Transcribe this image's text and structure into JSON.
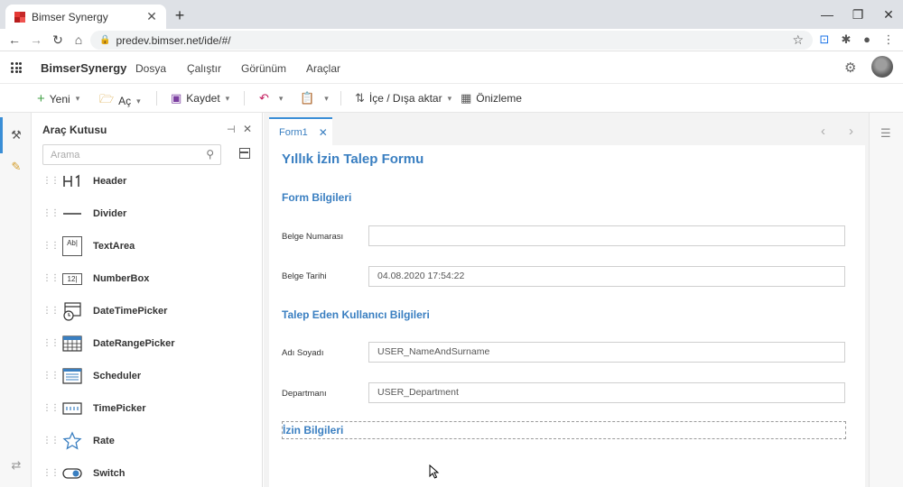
{
  "browser": {
    "tab_title": "Bimser Synergy",
    "url": "predev.bimser.net/ide/#/"
  },
  "app": {
    "brand": "BimserSynergy",
    "menu": [
      "Dosya",
      "Çalıştır",
      "Görünüm",
      "Araçlar"
    ]
  },
  "toolbar": {
    "new_label": "Yeni",
    "open_label": "Aç",
    "save_label": "Kaydet",
    "import_export_label": "İçe / Dışa aktar",
    "preview_label": "Önizleme"
  },
  "toolbox": {
    "title": "Araç Kutusu",
    "search_placeholder": "Arama",
    "items": [
      {
        "label": "Header",
        "icon": "header-icon"
      },
      {
        "label": "Divider",
        "icon": "divider-icon"
      },
      {
        "label": "TextArea",
        "icon": "textarea-icon"
      },
      {
        "label": "NumberBox",
        "icon": "numberbox-icon"
      },
      {
        "label": "DateTimePicker",
        "icon": "datetimepicker-icon"
      },
      {
        "label": "DateRangePicker",
        "icon": "daterangepicker-icon"
      },
      {
        "label": "Scheduler",
        "icon": "scheduler-icon"
      },
      {
        "label": "TimePicker",
        "icon": "timepicker-icon"
      },
      {
        "label": "Rate",
        "icon": "star-icon"
      },
      {
        "label": "Switch",
        "icon": "switch-icon"
      }
    ],
    "textarea_glyph": "Ab|",
    "numberbox_glyph": "12|"
  },
  "designer": {
    "tab_label": "Form1",
    "form_title": "Yıllık İzin Talep Formu",
    "sections": {
      "form_info": "Form Bilgileri",
      "requester_info": "Talep Eden Kullanıcı Bilgileri",
      "leave_info": "İzin Bilgileri"
    },
    "fields": {
      "doc_number_label": "Belge Numarası",
      "doc_number_value": "",
      "doc_date_label": "Belge Tarihi",
      "doc_date_value": "04.08.2020 17:54:22",
      "name_label": "Adı Soyadı",
      "name_value": "USER_NameAndSurname",
      "dept_label": "Departmanı",
      "dept_value": "USER_Department"
    }
  },
  "colors": {
    "accent": "#3a7fc1",
    "active_tab_border": "#3a8ed6"
  }
}
